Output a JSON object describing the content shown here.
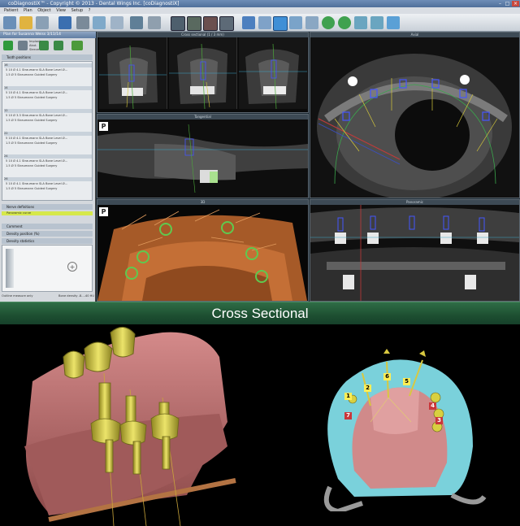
{
  "titlebar": {
    "title": "coDiagnostiX™ - Copyright © 2013 - Dental Wings Inc. [coDiagnostiX]"
  },
  "menubar": {
    "items": [
      "Patient",
      "Plan",
      "Object",
      "View",
      "Setup",
      "?"
    ]
  },
  "left_panel": {
    "plan_title": "Plan for Susanna Weiss 3/11/14",
    "small_labels": [
      "Implant",
      "Abut.",
      "Sleeve"
    ],
    "tooth_positions_header": "Tooth positions",
    "implants": [
      {
        "pos": "16",
        "line1": "5 10 Ø 4.1  Straumann SLA Bone Level Ø...",
        "line2": "1.5 Ø 5  Straumann Guided Surgery"
      },
      {
        "pos": "14",
        "line1": "5 10 Ø 4.1  Straumann SLA Bone Level Ø...",
        "line2": "1.5 Ø 5  Straumann Guided Surgery"
      },
      {
        "pos": "12",
        "line1": "5 10 Ø 3.3  Straumann SLA Bone Level Ø...",
        "line2": "1.5 Ø 5  Straumann Guided Surgery"
      },
      {
        "pos": "22",
        "line1": "5 10 Ø 4.1  Straumann SLA Bone Level Ø...",
        "line2": "1.5 Ø 5  Straumann Guided Surgery"
      },
      {
        "pos": "24",
        "line1": "5 10 Ø 4.1  Straumann SLA Bone Level Ø...",
        "line2": "1.5 Ø 5  Straumann Guided Surgery"
      },
      {
        "pos": "26",
        "line1": "5 10 Ø 4.1  Straumann SLA Bone Level Ø...",
        "line2": "1.5 Ø 5  Straumann Guided Surgery"
      }
    ],
    "nerve_header": "Nerve definitions",
    "nerve_item": "Panoramic curve",
    "sec_comment": "Comment",
    "sec_density_pos": "Density position (%)",
    "sec_density_stats": "Density statistics",
    "status_left": "Outline measure only",
    "status_right": "Bone density -8...-40 HU"
  },
  "viewports": {
    "cross_sectional": "Cross sectional (1 / 3 mm)",
    "axial": "Axial",
    "tangential": "Tangential",
    "view3d": "3D",
    "panoramic": "Panoramic",
    "p_badge": "P"
  },
  "banner": {
    "text": "Cross Sectional"
  },
  "bottom_right_labels": [
    "1",
    "2",
    "6",
    "5",
    "4",
    "3",
    "7"
  ],
  "colors": {
    "banner": "#1d4f31",
    "bone3d": "#b5652e",
    "gum": "#c97a7a",
    "abutment": "#c9c23c",
    "scan": "#6fc9d6"
  }
}
